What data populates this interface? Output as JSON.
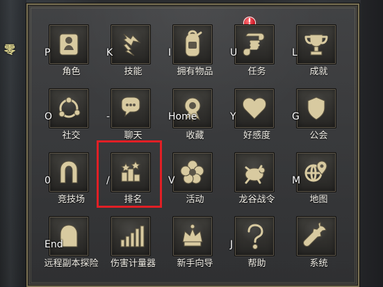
{
  "background": {
    "left_mark": "零"
  },
  "menu": {
    "items": [
      {
        "label": "角色",
        "hotkey": "P",
        "icon": "portrait-icon"
      },
      {
        "label": "技能",
        "hotkey": "K",
        "icon": "lightning-icon"
      },
      {
        "label": "拥有物品",
        "hotkey": "I",
        "icon": "backpack-icon"
      },
      {
        "label": "任务",
        "hotkey": "U",
        "icon": "scroll-icon",
        "alert": "!"
      },
      {
        "label": "成就",
        "hotkey": "L",
        "icon": "trophy-icon"
      },
      {
        "label": "社交",
        "hotkey": "O",
        "icon": "social-icon"
      },
      {
        "label": "聊天",
        "hotkey": "-",
        "icon": "chat-icon"
      },
      {
        "label": "收藏",
        "hotkey": "Home",
        "icon": "medal-icon"
      },
      {
        "label": "好感度",
        "hotkey": "Y",
        "icon": "heart-icon"
      },
      {
        "label": "公会",
        "hotkey": "G",
        "icon": "guild-shield-icon"
      },
      {
        "label": "竞技场",
        "hotkey": "0",
        "icon": "arch-icon"
      },
      {
        "label": "排名",
        "hotkey": "/",
        "icon": "podium-icon"
      },
      {
        "label": "活动",
        "hotkey": "V",
        "icon": "flower-icon"
      },
      {
        "label": "龙谷战令",
        "hotkey": "",
        "icon": "turtle-icon"
      },
      {
        "label": "地图",
        "hotkey": "M",
        "icon": "globe-pin-icon"
      },
      {
        "label": "远程副本探险",
        "hotkey": "End",
        "icon": "gate-icon"
      },
      {
        "label": "伤害计量器",
        "hotkey": "",
        "icon": "bars-icon"
      },
      {
        "label": "新手向导",
        "hotkey": "",
        "icon": "crown-icon"
      },
      {
        "label": "帮助",
        "hotkey": "J",
        "icon": "question-icon"
      },
      {
        "label": "系统",
        "hotkey": "",
        "icon": "wrench-icon"
      }
    ]
  },
  "colors": {
    "selection": "#e11f25",
    "alert": "#d31f2c",
    "icon_fill": "#d8caa0"
  }
}
